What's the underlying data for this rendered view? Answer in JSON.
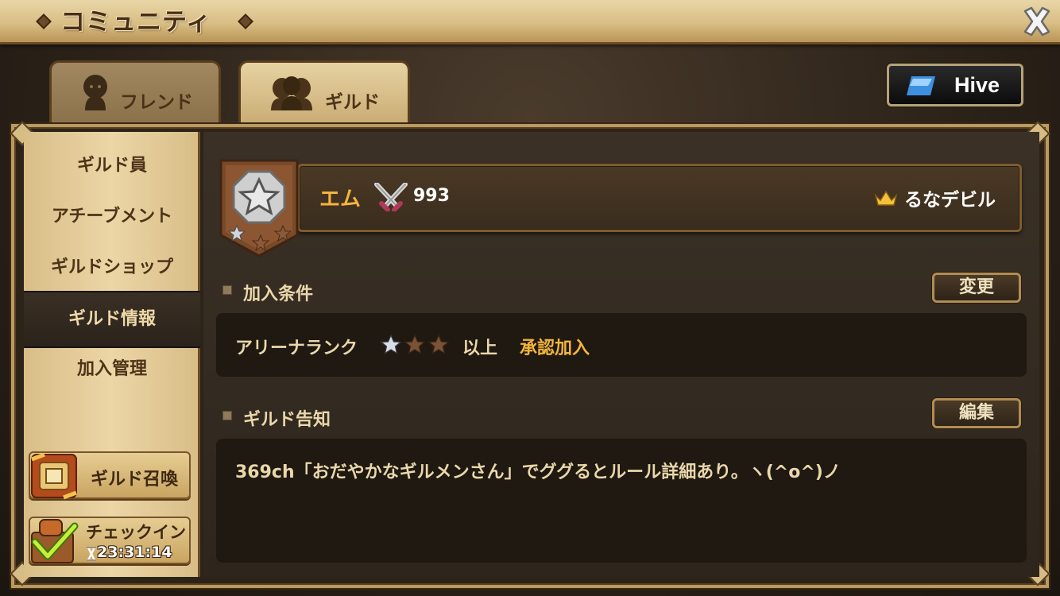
{
  "window": {
    "title": "コミュニティ",
    "close_icon": "close-x-icon"
  },
  "tabs": [
    {
      "label": "フレンド",
      "icon": "person-silhouette-icon",
      "selected": false
    },
    {
      "label": "ギルド",
      "icon": "group-silhouette-icon",
      "selected": true
    }
  ],
  "hive_button": {
    "label": "Hive",
    "icon": "hive-logo-icon"
  },
  "sidebar": {
    "items": [
      {
        "label": "ギルド員",
        "active": false
      },
      {
        "label": "アチーブメント",
        "active": false
      },
      {
        "label": "ギルドショップ",
        "active": false
      },
      {
        "label": "ギルド情報",
        "active": true
      },
      {
        "label": "加入管理",
        "active": false
      }
    ],
    "summon_button": {
      "label": "ギルド召喚",
      "icon": "scroll-summon-icon"
    },
    "checkin_button": {
      "label": "チェックイン",
      "timer": "23:31:14",
      "icon": "checkmark-chest-icon"
    }
  },
  "guild": {
    "name": "エム",
    "points": "993",
    "master": "るなデビル",
    "emblem_icon": "silver-star-emblem-icon",
    "emblem_stars_filled": 1,
    "emblem_stars_total": 3
  },
  "join_conditions": {
    "section_title": "加入条件",
    "change_button": "変更",
    "arena_rank_label": "アリーナランク",
    "arena_rank_stars_filled": 1,
    "arena_rank_stars_total": 3,
    "rank_qualifier": "以上",
    "join_type": "承認加入"
  },
  "notice": {
    "section_title": "ギルド告知",
    "edit_button": "編集",
    "text": "369ch「おだやかなギルメンさん」でググるとルール詳細あり。ヽ(^o^)ノ"
  },
  "colors": {
    "accent_gold": "#f3b53b",
    "panel_dark": "#1f1912",
    "sidebar_tan": "#ecd6a6"
  }
}
